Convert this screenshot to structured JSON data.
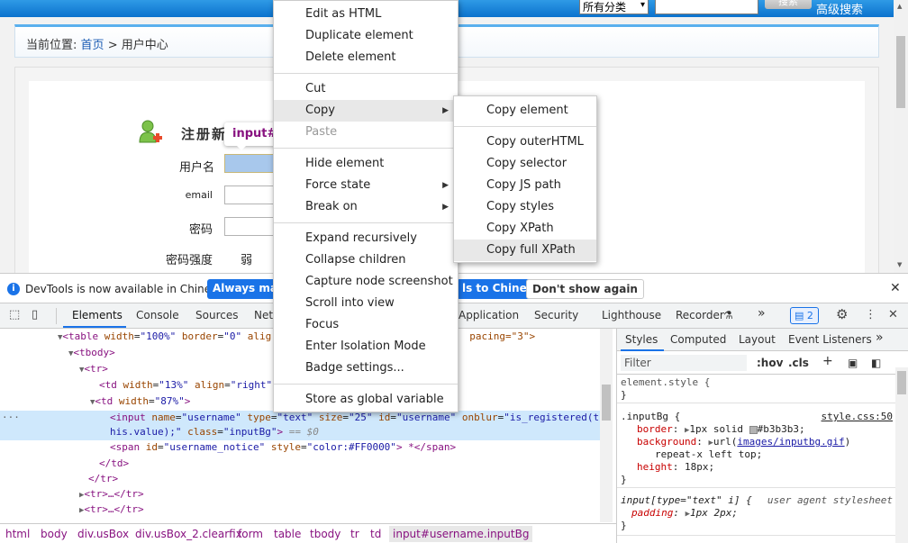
{
  "webpage": {
    "category_select": "所有分类",
    "search_button": "搜索",
    "advanced_search": "高级搜索",
    "breadcrumb": {
      "prefix": "当前位置:",
      "home": "首页",
      "sep": ">",
      "current": "用户中心"
    },
    "register_title": "注册新",
    "tooltip": "input#u",
    "labels": {
      "username": "用户名",
      "email": "email",
      "password": "密码",
      "strength": "密码强度"
    },
    "strength_value": "弱"
  },
  "infobar": {
    "message": "DevTools is now available in Chinese!",
    "always_match": "Always matc",
    "switch": "ls to Chinese",
    "dont_show": "Don't show again",
    "close": "✕"
  },
  "devtools_tabs": [
    "Elements",
    "Console",
    "Sources",
    "Net",
    "Application",
    "Security",
    "Lighthouse",
    "Recorder"
  ],
  "issues_count": "2",
  "dom": {
    "line0": {
      "tag_open": "<table ",
      "a1": "width",
      "v1": "\"100%\"",
      "a2": "border",
      "v2": "\"0\"",
      "a3": "alig",
      "tail": "pacing=\"3\">"
    },
    "line1": "<tbody>",
    "line2": "<tr>",
    "line3": {
      "tag": "<td ",
      "a1": "width",
      "v1": "\"13%\"",
      "a2": "align",
      "v2": "\"right\""
    },
    "line4": {
      "tag": "<td ",
      "a1": "width",
      "v1": "\"87%\"",
      "close": ">"
    },
    "line5": {
      "tag": "<input ",
      "a1": "name",
      "v1": "\"username\"",
      "a2": "type",
      "v2": "\"text\"",
      "a3": "size",
      "v3": "\"25\"",
      "a4": "id",
      "v4": "\"username\"",
      "a5": "onblur",
      "v5": "\"is_registered(t"
    },
    "line6": {
      "v": "his.value);\"",
      "a": "class",
      "cv": "\"inputBg\"",
      "close": ">",
      "dollar": "== $0"
    },
    "line7": {
      "tag": "<span ",
      "a1": "id",
      "v1": "\"username_notice\"",
      "a2": "style",
      "v2": "\"color:#FF0000\"",
      "text": "> *</span>"
    },
    "line8": "</td>",
    "line9": "</tr>",
    "line10": "<tr>…</tr>",
    "line11": "<tr>…</tr>"
  },
  "dom_path": [
    "html",
    "body",
    "div.usBox",
    "div.usBox_2.clearfix",
    "form",
    "table",
    "tbody",
    "tr",
    "td",
    "input#username.inputBg"
  ],
  "styles": {
    "tabs": [
      "Styles",
      "Computed",
      "Layout",
      "Event Listeners"
    ],
    "filter_placeholder": "Filter",
    "hov": ":hov",
    "cls": ".cls",
    "element_style": "element.style {",
    "close_brace": "}",
    "rule1": {
      "selector": ".inputBg {",
      "source": "style.css:50",
      "border_prop": "border",
      "border_val": "1px solid ",
      "border_color": "#b3b3b3",
      "bg_prop": "background",
      "bg_val_a": "url(",
      "bg_url": "images/inputbg.gif",
      "bg_val_b": ")",
      "bg_val_c": "repeat-x left top;",
      "height_prop": "height",
      "height_val": "18px;"
    },
    "rule2": {
      "selector": "input[type=\"text\" i] {",
      "source": "user agent stylesheet",
      "padding_prop": "padding",
      "padding_val": "1px 2px;"
    }
  },
  "context_menu": {
    "items": [
      {
        "label": "Edit as HTML"
      },
      {
        "label": "Duplicate element"
      },
      {
        "label": "Delete element"
      },
      {
        "label": "Cut"
      },
      {
        "label": "Copy"
      },
      {
        "label": "Paste"
      },
      {
        "label": "Hide element"
      },
      {
        "label": "Force state"
      },
      {
        "label": "Break on"
      },
      {
        "label": "Expand recursively"
      },
      {
        "label": "Collapse children"
      },
      {
        "label": "Capture node screenshot"
      },
      {
        "label": "Scroll into view"
      },
      {
        "label": "Focus"
      },
      {
        "label": "Enter Isolation Mode"
      },
      {
        "label": "Badge settings..."
      },
      {
        "label": "Store as global variable"
      }
    ]
  },
  "copy_submenu": {
    "items": [
      {
        "label": "Copy element"
      },
      {
        "label": "Copy outerHTML"
      },
      {
        "label": "Copy selector"
      },
      {
        "label": "Copy JS path"
      },
      {
        "label": "Copy styles"
      },
      {
        "label": "Copy XPath"
      },
      {
        "label": "Copy full XPath"
      }
    ]
  },
  "colors": {
    "accent": "#1a73e8",
    "tag": "#881280",
    "attr": "#994500",
    "value": "#1a1aa6",
    "selected_row": "#cfe8fc"
  }
}
